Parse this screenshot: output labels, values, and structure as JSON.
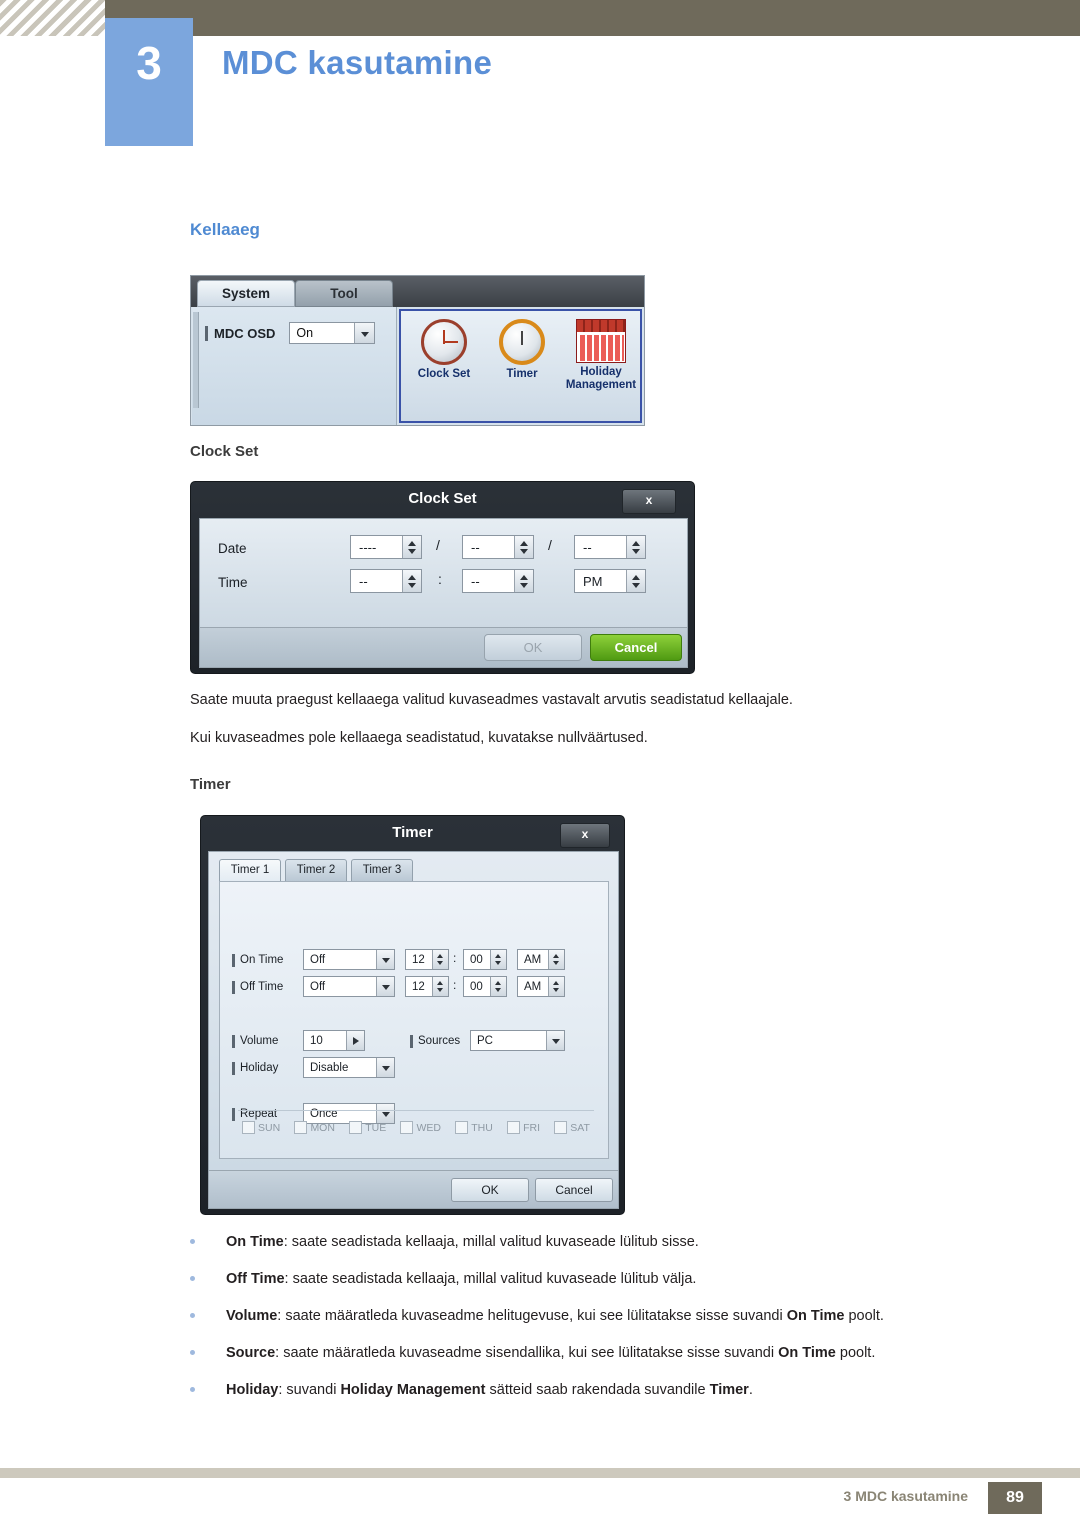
{
  "header": {
    "chapter_number": "3",
    "chapter_title": "MDC kasutamine"
  },
  "content": {
    "section_title": "Kellaaeg",
    "subtitle_clock": "Clock Set",
    "subtitle_timer": "Timer",
    "paragraph_1": "Saate muuta praegust kellaaega valitud kuvaseadmes vastavalt arvutis seadistatud kellaajale.",
    "paragraph_2": "Kui kuvaseadmes pole kellaaega seadistatud, kuvatakse nullväärtused."
  },
  "system_panel": {
    "tab_system": "System",
    "tab_tool": "Tool",
    "mdc_osd_label": "MDC OSD",
    "mdc_osd_value": "On",
    "icon_clock_line1": "Clock",
    "icon_clock_line2": "Set",
    "icon_timer": "Timer",
    "icon_holiday_line1": "Holiday",
    "icon_holiday_line2": "Management"
  },
  "clock_set_dialog": {
    "title": "Clock Set",
    "close_label": "x",
    "date_label": "Date",
    "time_label": "Time",
    "date_year": "----",
    "date_month": "--",
    "date_day": "--",
    "time_hour": "--",
    "time_minute": "--",
    "time_meridiem": "PM",
    "separator_date": "/",
    "separator_time": ":",
    "ok_label": "OK",
    "cancel_label": "Cancel"
  },
  "timer_dialog": {
    "title": "Timer",
    "close_label": "x",
    "tabs": [
      "Timer 1",
      "Timer 2",
      "Timer 3"
    ],
    "on_time_label": "On Time",
    "on_time_mode": "Off",
    "on_time_hour": "12",
    "on_time_minute": "00",
    "on_time_meridiem": "AM",
    "off_time_label": "Off Time",
    "off_time_mode": "Off",
    "off_time_hour": "12",
    "off_time_minute": "00",
    "off_time_meridiem": "AM",
    "volume_label": "Volume",
    "volume_value": "10",
    "sources_label": "Sources",
    "sources_value": "PC",
    "holiday_label": "Holiday",
    "holiday_value": "Disable",
    "repeat_label": "Repeat",
    "repeat_value": "Once",
    "separator_time": ":",
    "days": [
      "SUN",
      "MON",
      "TUE",
      "WED",
      "THU",
      "FRI",
      "SAT"
    ],
    "ok_label": "OK",
    "cancel_label": "Cancel"
  },
  "bullets": [
    {
      "parts": [
        {
          "text": "On Time",
          "bold": true
        },
        {
          "text": ": saate seadistada kellaaja, millal valitud kuvaseade lülitub sisse.",
          "bold": false
        }
      ]
    },
    {
      "parts": [
        {
          "text": "Off Time",
          "bold": true
        },
        {
          "text": ": saate seadistada kellaaja, millal valitud kuvaseade lülitub välja.",
          "bold": false
        }
      ]
    },
    {
      "parts": [
        {
          "text": "Volume",
          "bold": true
        },
        {
          "text": ": saate määratleda kuvaseadme helitugevuse, kui see lülitatakse sisse suvandi ",
          "bold": false
        },
        {
          "text": "On Time",
          "bold": true
        },
        {
          "text": " poolt.",
          "bold": false
        }
      ]
    },
    {
      "parts": [
        {
          "text": "Source",
          "bold": true
        },
        {
          "text": ": saate määratleda kuvaseadme sisendallika, kui see lülitatakse sisse suvandi ",
          "bold": false
        },
        {
          "text": "On Time",
          "bold": true
        },
        {
          "text": " poolt.",
          "bold": false
        }
      ]
    },
    {
      "parts": [
        {
          "text": "Holiday",
          "bold": true
        },
        {
          "text": ": suvandi ",
          "bold": false
        },
        {
          "text": "Holiday Management",
          "bold": true
        },
        {
          "text": " sätteid saab rakendada suvandile ",
          "bold": false
        },
        {
          "text": "Timer",
          "bold": true
        },
        {
          "text": ".",
          "bold": false
        }
      ]
    }
  ],
  "footer": {
    "text": "3 MDC kasutamine",
    "page": "89"
  },
  "colors": {
    "accent_blue": "#5b8fd6",
    "section_blue": "#4f8ad2",
    "header_brown": "#6f6a5b",
    "selection_border": "#3a52a8"
  }
}
